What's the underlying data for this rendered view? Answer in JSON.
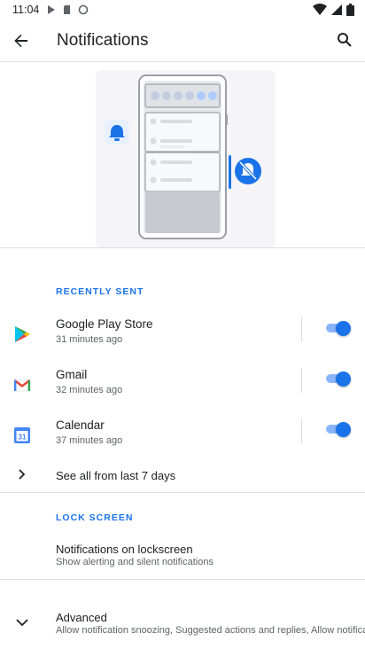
{
  "status_bar": {
    "time": "11:04"
  },
  "header": {
    "title": "Notifications"
  },
  "recently_sent": {
    "header": "RECENTLY SENT",
    "apps": [
      {
        "name": "Google Play Store",
        "time": "31 minutes ago",
        "enabled": true
      },
      {
        "name": "Gmail",
        "time": "32 minutes ago",
        "enabled": true
      },
      {
        "name": "Calendar",
        "time": "37 minutes ago",
        "enabled": true
      }
    ],
    "see_all": "See all from last 7 days"
  },
  "lock_screen": {
    "header": "LOCK SCREEN",
    "item_title": "Notifications on lockscreen",
    "item_subtitle": "Show alerting and silent notifications"
  },
  "advanced": {
    "title": "Advanced",
    "subtitle": "Allow notification snoozing, Suggested actions and replies, Allow notificati..."
  },
  "colors": {
    "accent": "#1a73e8",
    "track": "#8ab4f8"
  },
  "icons": [
    "back-arrow-icon",
    "search-icon",
    "play-store-icon",
    "gmail-icon",
    "calendar-icon",
    "chevron-right-icon",
    "chevron-down-icon"
  ]
}
